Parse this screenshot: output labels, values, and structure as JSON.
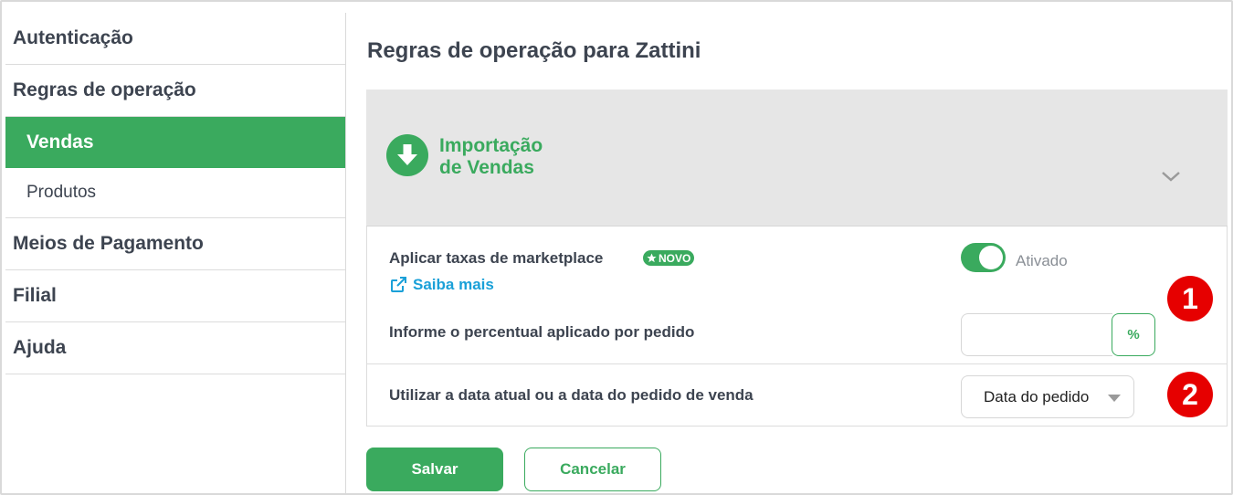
{
  "sidebar": {
    "items": [
      {
        "label": "Autenticação"
      },
      {
        "label": "Regras de operação"
      },
      {
        "label": "Vendas"
      },
      {
        "label": "Produtos"
      },
      {
        "label": "Meios de Pagamento"
      },
      {
        "label": "Filial"
      },
      {
        "label": "Ajuda"
      }
    ],
    "active_item": "Vendas"
  },
  "main": {
    "title": "Regras de operação para Zattini",
    "panel": {
      "icon": "download-circle-icon",
      "title_line1": "Importação",
      "title_line2": "de Vendas",
      "expand_icon": "chevron-down-icon"
    },
    "rules": {
      "marketplace_fee_label": "Aplicar taxas de marketplace",
      "new_badge": "NOVO",
      "learn_more_link": "Saiba mais",
      "toggle_state_label": "Ativado",
      "toggle_on": true,
      "percent_label": "Informe o percentual aplicado por pedido",
      "percent_value": "",
      "percent_button": "%",
      "date_label": "Utilizar a data atual ou a data do pedido de venda",
      "date_selected": "Data do pedido"
    },
    "markers": [
      "1",
      "2"
    ],
    "actions": {
      "save": "Salvar",
      "cancel": "Cancelar"
    }
  },
  "colors": {
    "accent": "#3aaa5e",
    "link": "#1aa0d8",
    "marker": "#e60000",
    "panel_bg": "#e6e6e6"
  }
}
